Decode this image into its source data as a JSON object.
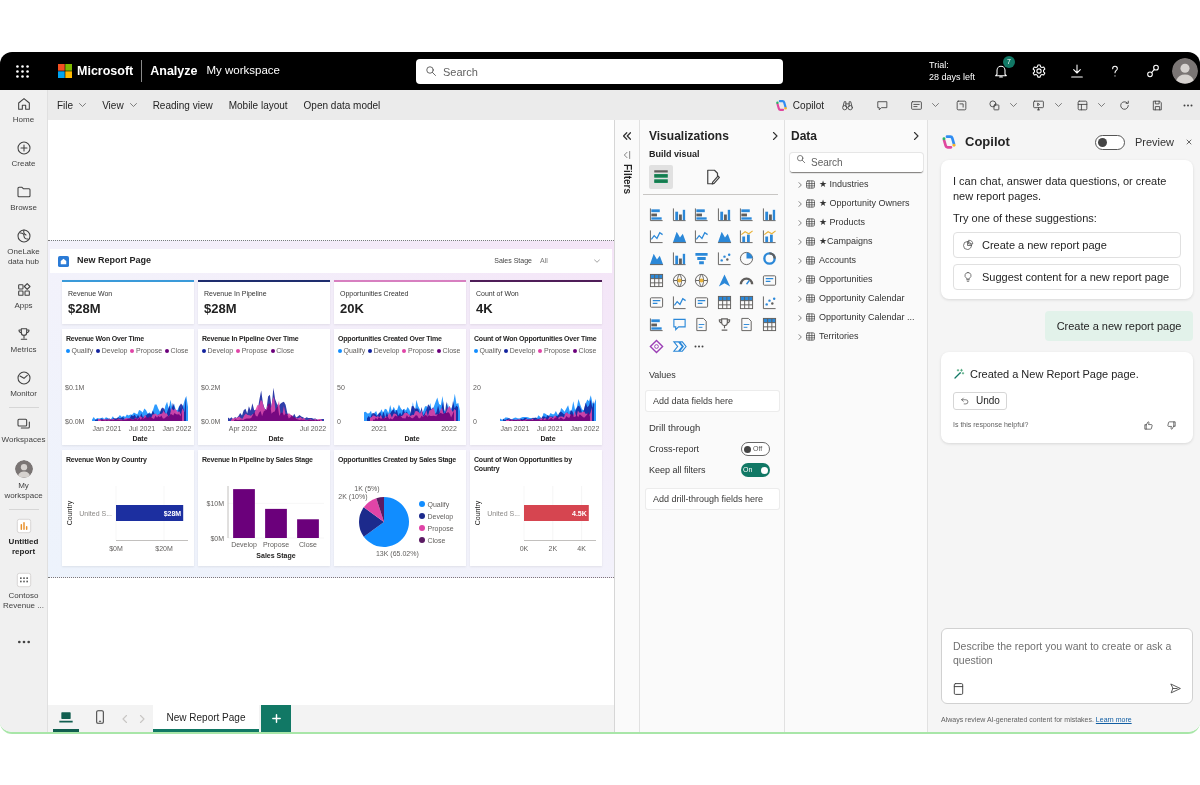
{
  "top_bar": {
    "brand": "Microsoft",
    "section": "Analyze",
    "workspace": "My workspace",
    "search": {
      "placeholder": "Search"
    },
    "trial": "Trial:",
    "trial_days": "28 days left",
    "notification_count": "7"
  },
  "nav": [
    {
      "label": "Home",
      "selected": false
    },
    {
      "label": "Create",
      "selected": false
    },
    {
      "label": "Browse",
      "selected": false
    },
    {
      "label": "OneLake data hub",
      "selected": false
    },
    {
      "label": "Apps",
      "selected": false
    },
    {
      "label": "Metrics",
      "selected": false
    },
    {
      "label": "Monitor",
      "selected": false
    },
    {
      "label": "Workspaces",
      "selected": false
    },
    {
      "label": "My workspace",
      "selected": false
    },
    {
      "label": "Untitled report",
      "selected": true
    },
    {
      "label": "Contoso Revenue ...",
      "selected": false
    }
  ],
  "menu": [
    {
      "label": "File",
      "kind": "dropdown"
    },
    {
      "label": "View",
      "kind": "dropdown"
    },
    {
      "label": "Reading view",
      "kind": "command"
    },
    {
      "label": "Mobile layout",
      "kind": "command"
    },
    {
      "label": "Open data model",
      "kind": "command"
    }
  ],
  "toolbar": {
    "copilot": "Copilot"
  },
  "report": {
    "title": "New Report Page",
    "slicer": {
      "label": "Sales Stage",
      "value": "All"
    },
    "kpis": [
      {
        "title": "Revenue Won",
        "value": "$28M",
        "color": "#3a9ad9"
      },
      {
        "title": "Revenue In Pipeline",
        "value": "$28M",
        "color": "#1e2d6e"
      },
      {
        "title": "Opportunities Created",
        "value": "20K",
        "color": "#d77fc0"
      },
      {
        "title": "Count of Won",
        "value": "4K",
        "color": "#4f1d58"
      }
    ],
    "visuals": [
      {
        "kind": "area",
        "title": "Revenue Won Over Time",
        "legend": [
          {
            "label": "Qualify",
            "color": "#118dff"
          },
          {
            "label": "Develop",
            "color": "#12239e"
          },
          {
            "label": "Propose",
            "color": "#e044a7"
          },
          {
            "label": "Close",
            "color": "#6b007b"
          }
        ],
        "y_ticks": [
          "$0.1M",
          "$0.0M"
        ],
        "x_ticks": [
          "Jan 2021",
          "Jul 2021",
          "Jan 2022"
        ],
        "x_title": "Date"
      },
      {
        "kind": "area",
        "title": "Revenue In Pipeline Over Time",
        "legend": [
          {
            "label": "Develop",
            "color": "#12239e"
          },
          {
            "label": "Propose",
            "color": "#e044a7"
          },
          {
            "label": "Close",
            "color": "#6b007b"
          }
        ],
        "y_ticks": [
          "$0.2M",
          "$0.0M"
        ],
        "x_ticks": [
          "Apr 2022",
          "Jul 2022"
        ],
        "x_title": "Date"
      },
      {
        "kind": "area",
        "title": "Opportunities Created Over Time",
        "legend": [
          {
            "label": "Qualify",
            "color": "#118dff"
          },
          {
            "label": "Develop",
            "color": "#12239e"
          },
          {
            "label": "Propose",
            "color": "#e044a7"
          },
          {
            "label": "Close",
            "color": "#6b007b"
          }
        ],
        "y_ticks": [
          "50",
          "0"
        ],
        "x_ticks": [
          "2021",
          "2022"
        ],
        "x_title": "Date"
      },
      {
        "kind": "area",
        "title": "Count of Won Opportunities Over Time",
        "legend": [
          {
            "label": "Qualify",
            "color": "#118dff"
          },
          {
            "label": "Develop",
            "color": "#12239e"
          },
          {
            "label": "Propose",
            "color": "#e044a7"
          },
          {
            "label": "Close",
            "color": "#6b007b"
          }
        ],
        "y_ticks": [
          "20",
          "0"
        ],
        "x_ticks": [
          "Jan 2021",
          "Jul 2021",
          "Jan 2022"
        ],
        "x_title": "Date"
      },
      {
        "kind": "chart",
        "chart_data": {
          "type": "bar",
          "orientation": "horizontal",
          "title": "Revenue Won by Country",
          "ylabel": "Country",
          "categories": [
            "United S..."
          ],
          "series": [
            {
              "color": "#1c2fa0",
              "values": [
                28
              ]
            }
          ],
          "xlim": [
            0,
            30
          ],
          "xticks": [
            {
              "value": 0,
              "label": "$0M"
            },
            {
              "value": 20,
              "label": "$20M"
            }
          ],
          "value_labels": [
            "$28M"
          ]
        }
      },
      {
        "kind": "chart",
        "chart_data": {
          "type": "bar",
          "orientation": "vertical",
          "title": "Revenue In Pipeline by Sales Stage",
          "xlabel": "Sales Stage",
          "categories": [
            "Develop",
            "Propose",
            "Close"
          ],
          "series": [
            {
              "color": "#6b007b",
              "values": [
                14.1,
                8.4,
                5.4
              ]
            }
          ],
          "ylim": [
            0,
            15
          ],
          "yticks": [
            {
              "value": 0,
              "label": "$0M"
            },
            {
              "value": 10,
              "label": "$10M"
            }
          ]
        }
      },
      {
        "kind": "chart",
        "slices": [
          {
            "color": "#118dff"
          },
          {
            "color": "#1c2a8c"
          },
          {
            "color": "#e044a7"
          },
          {
            "color": "#5b1b63"
          }
        ],
        "chart_data": {
          "type": "pie",
          "title": "Opportunities Created by Sales Stage",
          "categories": [
            "Qualify",
            "Develop",
            "Propose",
            "Close"
          ],
          "values": [
            13000,
            4000,
            2000,
            1000
          ],
          "value_labels": [
            "13K (65.02%)",
            null,
            "2K (10%)",
            "1K (5%)"
          ],
          "legend": "right"
        }
      },
      {
        "kind": "chart",
        "chart_data": {
          "type": "bar",
          "orientation": "horizontal",
          "title": "Count of Won Opportunities by Country",
          "ylabel": "Country",
          "categories": [
            "United S..."
          ],
          "series": [
            {
              "color": "#d64550",
              "values": [
                4.5
              ]
            }
          ],
          "xlim": [
            0,
            5
          ],
          "xticks": [
            {
              "value": 0,
              "label": "0K"
            },
            {
              "value": 2,
              "label": "2K"
            },
            {
              "value": 4,
              "label": "4K"
            }
          ],
          "value_labels": [
            "4.5K"
          ]
        }
      }
    ]
  },
  "page_tabs": {
    "views": [
      {
        "selected": true
      },
      {
        "selected": false
      }
    ],
    "scroll_buttons": [
      {
        "disabled": true
      },
      {
        "disabled": true
      }
    ],
    "tabs": [
      {
        "label": "New Report Page",
        "selected": true
      }
    ]
  },
  "filters": {
    "title": "Filters"
  },
  "visualizations": {
    "title": "Visualizations",
    "build_title": "Build visual",
    "build_tabs": [
      {
        "selected": true
      },
      {
        "selected": false
      }
    ],
    "values_title": "Values",
    "values_field": {
      "placeholder": "Add data fields here"
    },
    "drill_title": "Drill through",
    "toggles": [
      {
        "label": "Cross-report",
        "on": false,
        "state": "Off"
      },
      {
        "label": "Keep all filters",
        "on": true,
        "state": "On"
      }
    ],
    "drill_field": {
      "placeholder": "Add drill-through fields here"
    }
  },
  "data": {
    "title": "Data",
    "search": {
      "placeholder": "Search"
    },
    "tables": [
      {
        "label": "★ Industries",
        "expanded": false
      },
      {
        "label": "★ Opportunity Owners",
        "expanded": false
      },
      {
        "label": "★ Products",
        "expanded": false
      },
      {
        "label": "★Campaigns",
        "expanded": false
      },
      {
        "label": "Accounts",
        "expanded": false
      },
      {
        "label": "Opportunities",
        "expanded": false
      },
      {
        "label": "Opportunity Calendar",
        "expanded": false
      },
      {
        "label": "Opportunity Calendar ...",
        "expanded": false
      },
      {
        "label": "Territories",
        "expanded": false
      }
    ]
  },
  "copilot": {
    "title": "Copilot",
    "preview": {
      "label": "Preview",
      "on": false
    },
    "intro": "I can chat, answer data questions, or create new report pages.",
    "prompt": "Try one of these suggestions:",
    "suggestions": [
      "Create a new report page",
      "Suggest content for a new report page"
    ],
    "messages": [
      {
        "kind": "user",
        "text": "Create a new report page"
      },
      {
        "kind": "response",
        "text": "Created a New Report Page page.",
        "action": "Undo",
        "feedback": "Is this response helpful?"
      }
    ],
    "input": {
      "placeholder": "Describe the report you want to create or ask a question"
    },
    "disclaimer": "Always review AI-generated content for mistakes.",
    "link": "Learn more"
  }
}
